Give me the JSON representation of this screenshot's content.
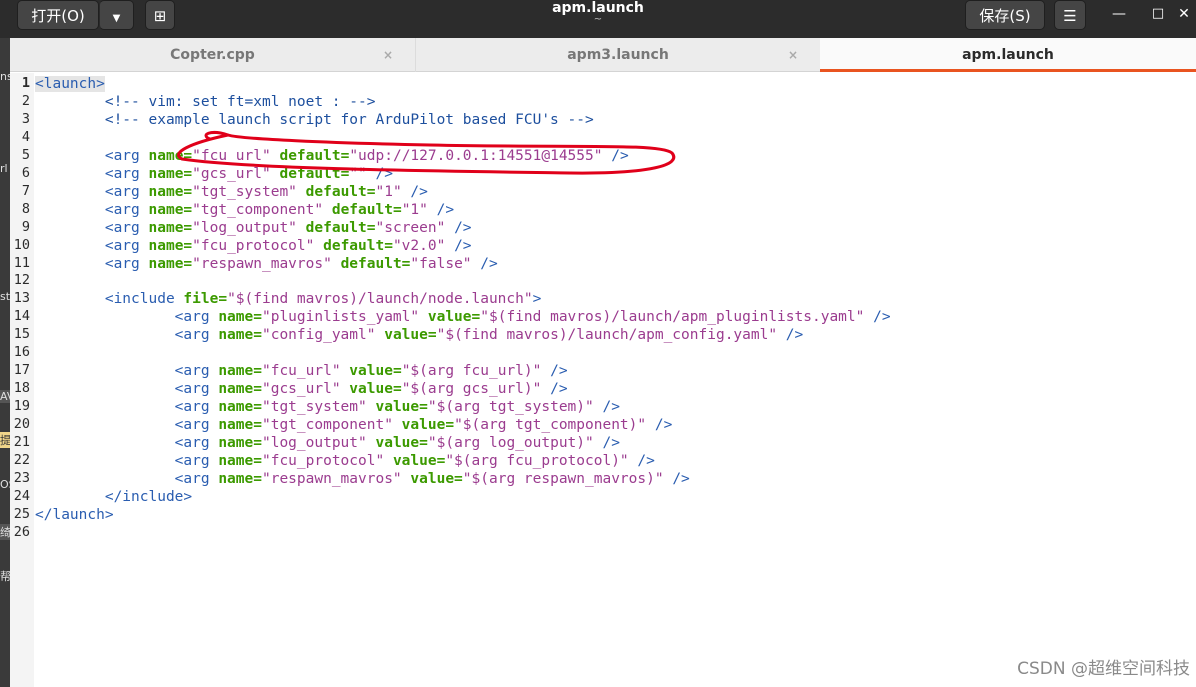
{
  "header": {
    "open_label": "打开(O)",
    "open_menu_icon": "▼",
    "new_tab_icon": "⊞",
    "title": "apm.launch",
    "subtitle": "~",
    "save_label": "保存(S)",
    "menu_icon": "☰",
    "minimize_icon": "—",
    "maximize_icon": "□",
    "close_icon": "✕"
  },
  "left_strip": [
    "ns",
    "rl",
    "st",
    "AV",
    "提",
    "OS",
    "绮",
    "帮"
  ],
  "tabs": [
    {
      "label": "Copter.cpp",
      "close": "×"
    },
    {
      "label": "apm3.launch",
      "close": "×"
    },
    {
      "label": "apm.launch",
      "close": "×"
    }
  ],
  "editor": {
    "line_numbers": [
      "1",
      "2",
      "3",
      "4",
      "5",
      "6",
      "7",
      "8",
      "9",
      "10",
      "11",
      "12",
      "13",
      "14",
      "15",
      "16",
      "17",
      "18",
      "19",
      "20",
      "21",
      "22",
      "23",
      "24",
      "25",
      "26"
    ],
    "lines": [
      [
        {
          "t": "<launch>",
          "c": "hl tag"
        }
      ],
      [
        {
          "t": "        <!-- vim: set ft=xml noet : -->",
          "c": "cmt"
        }
      ],
      [
        {
          "t": "        <!-- example launch script for ArduPilot based FCU's -->",
          "c": "cmt"
        }
      ],
      [],
      [
        {
          "t": "        <arg ",
          "c": "tag"
        },
        {
          "t": "name=",
          "c": "attr"
        },
        {
          "t": "\"fcu_url\"",
          "c": "str"
        },
        {
          "t": " ",
          "c": ""
        },
        {
          "t": "default=",
          "c": "attr"
        },
        {
          "t": "\"udp://127.0.0.1:14551@14555\"",
          "c": "str"
        },
        {
          "t": " />",
          "c": "tag"
        }
      ],
      [
        {
          "t": "        <arg ",
          "c": "tag"
        },
        {
          "t": "name=",
          "c": "attr"
        },
        {
          "t": "\"gcs_url\"",
          "c": "str"
        },
        {
          "t": " ",
          "c": ""
        },
        {
          "t": "default=",
          "c": "attr"
        },
        {
          "t": "\"\"",
          "c": "str"
        },
        {
          "t": " />",
          "c": "tag"
        }
      ],
      [
        {
          "t": "        <arg ",
          "c": "tag"
        },
        {
          "t": "name=",
          "c": "attr"
        },
        {
          "t": "\"tgt_system\"",
          "c": "str"
        },
        {
          "t": " ",
          "c": ""
        },
        {
          "t": "default=",
          "c": "attr"
        },
        {
          "t": "\"1\"",
          "c": "str"
        },
        {
          "t": " />",
          "c": "tag"
        }
      ],
      [
        {
          "t": "        <arg ",
          "c": "tag"
        },
        {
          "t": "name=",
          "c": "attr"
        },
        {
          "t": "\"tgt_component\"",
          "c": "str"
        },
        {
          "t": " ",
          "c": ""
        },
        {
          "t": "default=",
          "c": "attr"
        },
        {
          "t": "\"1\"",
          "c": "str"
        },
        {
          "t": " />",
          "c": "tag"
        }
      ],
      [
        {
          "t": "        <arg ",
          "c": "tag"
        },
        {
          "t": "name=",
          "c": "attr"
        },
        {
          "t": "\"log_output\"",
          "c": "str"
        },
        {
          "t": " ",
          "c": ""
        },
        {
          "t": "default=",
          "c": "attr"
        },
        {
          "t": "\"screen\"",
          "c": "str"
        },
        {
          "t": " />",
          "c": "tag"
        }
      ],
      [
        {
          "t": "        <arg ",
          "c": "tag"
        },
        {
          "t": "name=",
          "c": "attr"
        },
        {
          "t": "\"fcu_protocol\"",
          "c": "str"
        },
        {
          "t": " ",
          "c": ""
        },
        {
          "t": "default=",
          "c": "attr"
        },
        {
          "t": "\"v2.0\"",
          "c": "str"
        },
        {
          "t": " />",
          "c": "tag"
        }
      ],
      [
        {
          "t": "        <arg ",
          "c": "tag"
        },
        {
          "t": "name=",
          "c": "attr"
        },
        {
          "t": "\"respawn_mavros\"",
          "c": "str"
        },
        {
          "t": " ",
          "c": ""
        },
        {
          "t": "default=",
          "c": "attr"
        },
        {
          "t": "\"false\"",
          "c": "str"
        },
        {
          "t": " />",
          "c": "tag"
        }
      ],
      [],
      [
        {
          "t": "        <include ",
          "c": "tag"
        },
        {
          "t": "file=",
          "c": "attr"
        },
        {
          "t": "\"$(find mavros)/launch/node.launch\"",
          "c": "str"
        },
        {
          "t": ">",
          "c": "tag"
        }
      ],
      [
        {
          "t": "                <arg ",
          "c": "tag"
        },
        {
          "t": "name=",
          "c": "attr"
        },
        {
          "t": "\"pluginlists_yaml\"",
          "c": "str"
        },
        {
          "t": " ",
          "c": ""
        },
        {
          "t": "value=",
          "c": "attr"
        },
        {
          "t": "\"$(find mavros)/launch/apm_pluginlists.yaml\"",
          "c": "str"
        },
        {
          "t": " />",
          "c": "tag"
        }
      ],
      [
        {
          "t": "                <arg ",
          "c": "tag"
        },
        {
          "t": "name=",
          "c": "attr"
        },
        {
          "t": "\"config_yaml\"",
          "c": "str"
        },
        {
          "t": " ",
          "c": ""
        },
        {
          "t": "value=",
          "c": "attr"
        },
        {
          "t": "\"$(find mavros)/launch/apm_config.yaml\"",
          "c": "str"
        },
        {
          "t": " />",
          "c": "tag"
        }
      ],
      [],
      [
        {
          "t": "                <arg ",
          "c": "tag"
        },
        {
          "t": "name=",
          "c": "attr"
        },
        {
          "t": "\"fcu_url\"",
          "c": "str"
        },
        {
          "t": " ",
          "c": ""
        },
        {
          "t": "value=",
          "c": "attr"
        },
        {
          "t": "\"$(arg fcu_url)\"",
          "c": "str"
        },
        {
          "t": " />",
          "c": "tag"
        }
      ],
      [
        {
          "t": "                <arg ",
          "c": "tag"
        },
        {
          "t": "name=",
          "c": "attr"
        },
        {
          "t": "\"gcs_url\"",
          "c": "str"
        },
        {
          "t": " ",
          "c": ""
        },
        {
          "t": "value=",
          "c": "attr"
        },
        {
          "t": "\"$(arg gcs_url)\"",
          "c": "str"
        },
        {
          "t": " />",
          "c": "tag"
        }
      ],
      [
        {
          "t": "                <arg ",
          "c": "tag"
        },
        {
          "t": "name=",
          "c": "attr"
        },
        {
          "t": "\"tgt_system\"",
          "c": "str"
        },
        {
          "t": " ",
          "c": ""
        },
        {
          "t": "value=",
          "c": "attr"
        },
        {
          "t": "\"$(arg tgt_system)\"",
          "c": "str"
        },
        {
          "t": " />",
          "c": "tag"
        }
      ],
      [
        {
          "t": "                <arg ",
          "c": "tag"
        },
        {
          "t": "name=",
          "c": "attr"
        },
        {
          "t": "\"tgt_component\"",
          "c": "str"
        },
        {
          "t": " ",
          "c": ""
        },
        {
          "t": "value=",
          "c": "attr"
        },
        {
          "t": "\"$(arg tgt_component)\"",
          "c": "str"
        },
        {
          "t": " />",
          "c": "tag"
        }
      ],
      [
        {
          "t": "                <arg ",
          "c": "tag"
        },
        {
          "t": "name=",
          "c": "attr"
        },
        {
          "t": "\"log_output\"",
          "c": "str"
        },
        {
          "t": " ",
          "c": ""
        },
        {
          "t": "value=",
          "c": "attr"
        },
        {
          "t": "\"$(arg log_output)\"",
          "c": "str"
        },
        {
          "t": " />",
          "c": "tag"
        }
      ],
      [
        {
          "t": "                <arg ",
          "c": "tag"
        },
        {
          "t": "name=",
          "c": "attr"
        },
        {
          "t": "\"fcu_protocol\"",
          "c": "str"
        },
        {
          "t": " ",
          "c": ""
        },
        {
          "t": "value=",
          "c": "attr"
        },
        {
          "t": "\"$(arg fcu_protocol)\"",
          "c": "str"
        },
        {
          "t": " />",
          "c": "tag"
        }
      ],
      [
        {
          "t": "                <arg ",
          "c": "tag"
        },
        {
          "t": "name=",
          "c": "attr"
        },
        {
          "t": "\"respawn_mavros\"",
          "c": "str"
        },
        {
          "t": " ",
          "c": ""
        },
        {
          "t": "value=",
          "c": "attr"
        },
        {
          "t": "\"$(arg respawn_mavros)\"",
          "c": "str"
        },
        {
          "t": " />",
          "c": "tag"
        }
      ],
      [
        {
          "t": "        </include>",
          "c": "tag"
        }
      ],
      [
        {
          "t": "</launch>",
          "c": "tag"
        }
      ],
      []
    ]
  },
  "watermark": "CSDN @超维空间科技",
  "colors": {
    "accent": "#e95420",
    "annotation": "#e0001a"
  }
}
